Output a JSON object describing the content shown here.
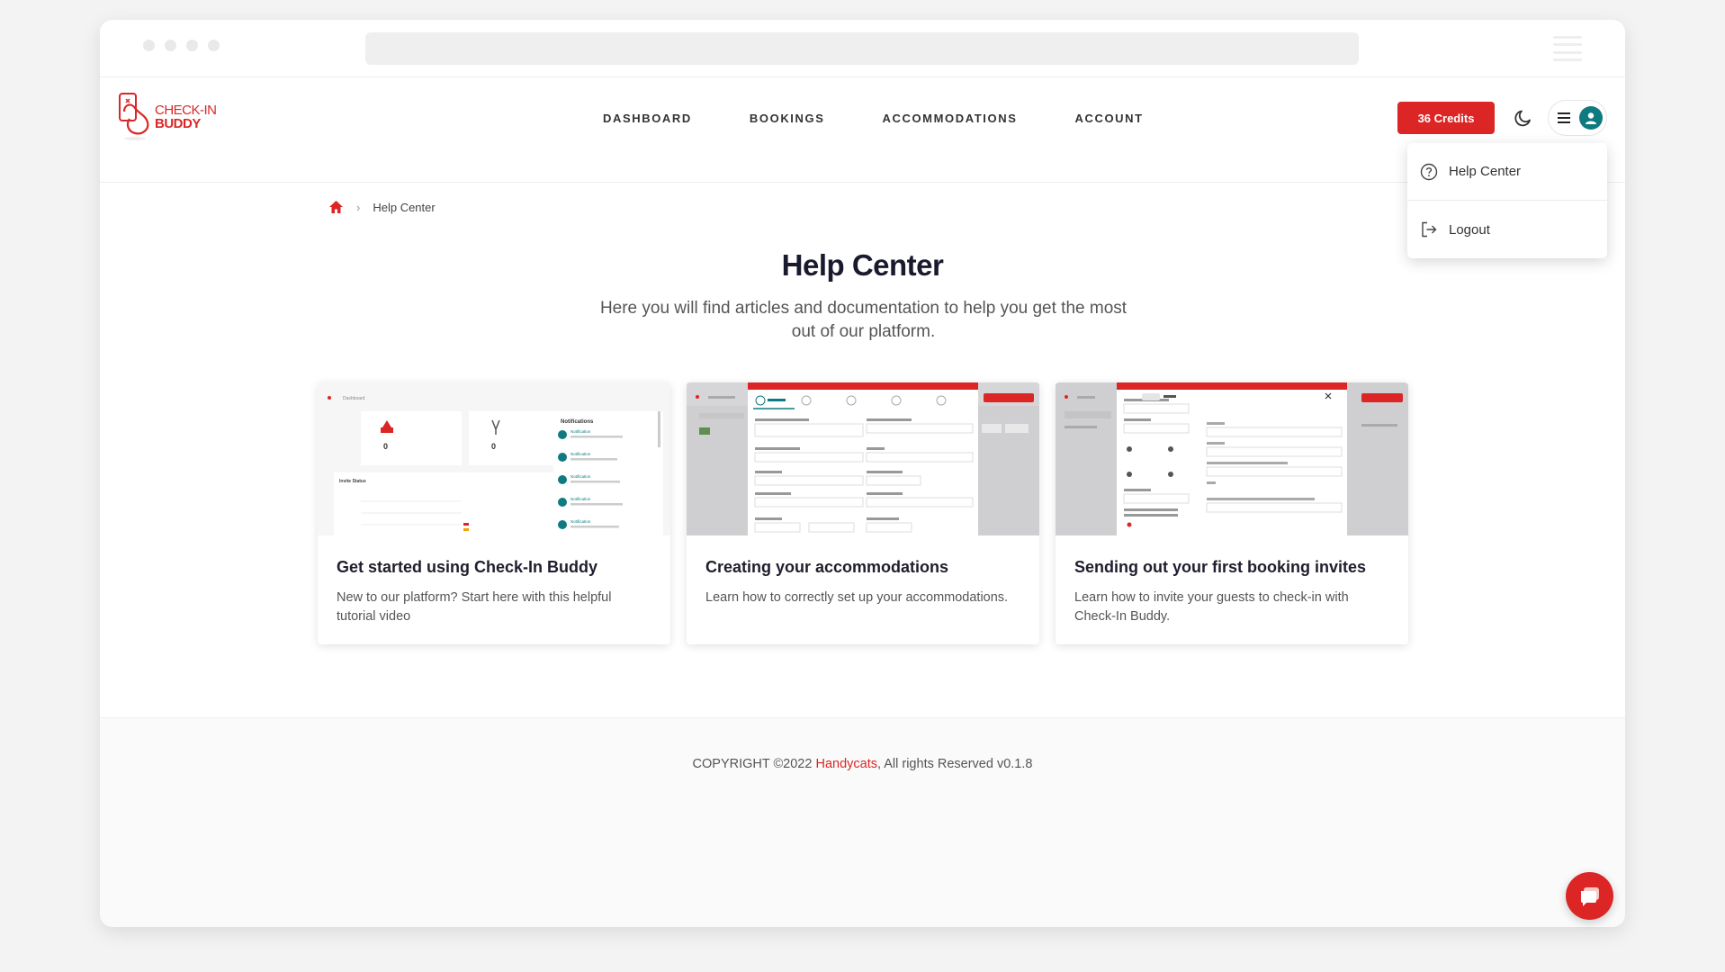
{
  "header": {
    "logo": {
      "line1": "CHECK-IN",
      "line2": "BUDDY"
    },
    "nav": [
      {
        "label": "DASHBOARD"
      },
      {
        "label": "BOOKINGS"
      },
      {
        "label": "ACCOMMODATIONS"
      },
      {
        "label": "ACCOUNT"
      }
    ],
    "credits_label": "36 Credits",
    "theme_icon": "moon-icon",
    "menu_icon": "hamburger-icon",
    "avatar_icon": "user-icon"
  },
  "dropdown": {
    "items": [
      {
        "label": "Help Center",
        "icon": "question-circle-icon"
      },
      {
        "label": "Logout",
        "icon": "logout-icon"
      }
    ]
  },
  "breadcrumb": {
    "home_icon": "home-icon",
    "current": "Help Center"
  },
  "main": {
    "title": "Help Center",
    "subtitle": "Here you will find articles and documentation to help you get the most out of our platform."
  },
  "cards": [
    {
      "title": "Get started using Check-In Buddy",
      "description": "New to our platform? Start here with this helpful tutorial video",
      "thumb": {
        "crumb": "Dashboard",
        "stat1": "0",
        "stat2": "0",
        "panel_title": "Notifications",
        "chart_title": "Invite Status",
        "notification_label": "Notification"
      }
    },
    {
      "title": "Creating your accommodations",
      "description": "Learn how to correctly set up your accommodations."
    },
    {
      "title": "Sending out your first booking invites",
      "description": "Learn how to invite your guests to check-in with Check-In Buddy."
    }
  ],
  "footer": {
    "prefix": "COPYRIGHT ©2022 ",
    "brand": "Handycats",
    "suffix": ", All rights Reserved v0.1.8"
  },
  "colors": {
    "accent": "#dc2626",
    "avatar": "#0f7a80",
    "text_dark": "#1a1a2e"
  },
  "chat_icon": "chat-icon"
}
